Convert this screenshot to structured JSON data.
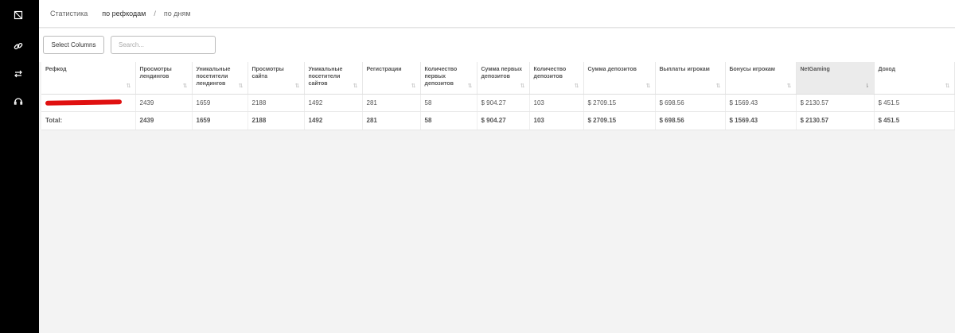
{
  "sidebar": {
    "icons": [
      {
        "name": "dashboard-icon"
      },
      {
        "name": "link-icon"
      },
      {
        "name": "transfer-icon"
      },
      {
        "name": "support-icon"
      }
    ]
  },
  "breadcrumb": {
    "root": "Статистика",
    "active": "по рефкодам",
    "separator": "/",
    "other": "по дням"
  },
  "toolbar": {
    "select_columns_label": "Select Columns",
    "search_placeholder": "Search..."
  },
  "table": {
    "columns": [
      "Рефкод",
      "Просмотры лендингов",
      "Уникальные посетители лендингов",
      "Просмотры сайта",
      "Уникальные посетители сайтов",
      "Регистрации",
      "Количество первых депозитов",
      "Сумма первых депозитов",
      "Количество депозитов",
      "Сумма депозитов",
      "Выплаты игрокам",
      "Бонусы игрокам",
      "NetGaming",
      "Доход"
    ],
    "rows": [
      [
        "",
        "2439",
        "1659",
        "2188",
        "1492",
        "281",
        "58",
        "$ 904.27",
        "103",
        "$ 2709.15",
        "$ 698.56",
        "$ 1569.43",
        "$ 2130.57",
        "$ 451.5"
      ]
    ],
    "total": [
      "Total:",
      "2439",
      "1659",
      "2188",
      "1492",
      "281",
      "58",
      "$ 904.27",
      "103",
      "$ 2709.15",
      "$ 698.56",
      "$ 1569.43",
      "$ 2130.57",
      "$ 451.5"
    ]
  },
  "colors": {
    "sidebar_bg": "#000000",
    "redaction": "#e01010"
  }
}
